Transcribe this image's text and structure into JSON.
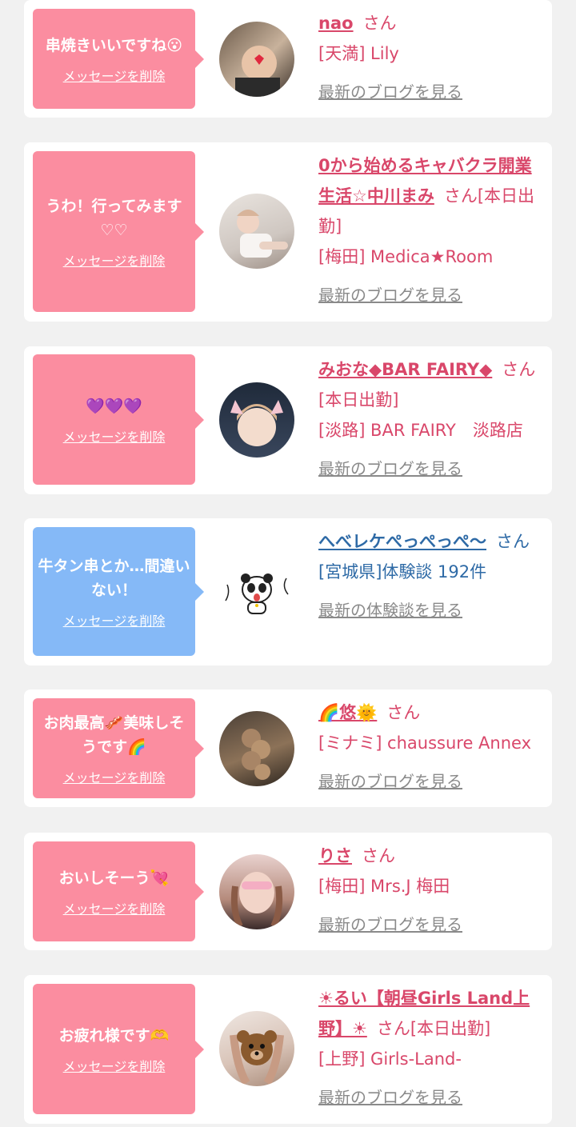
{
  "items": [
    {
      "message": "串焼きいいですね😮",
      "delete_label": "メッセージを削除",
      "name": "nao",
      "honorific": "さん",
      "shop": "[天満] Lily",
      "link": "最新のブログを見る",
      "theme": "pink"
    },
    {
      "message": "うわ！行ってみます♡♡",
      "delete_label": "メッセージを削除",
      "name": "0から始めるキャバクラ開業生活☆中川まみ",
      "honorific": "さん[本日出勤]",
      "shop": "[梅田] Medica★Room",
      "link": "最新のブログを見る",
      "theme": "pink"
    },
    {
      "message": "💜💜💜",
      "delete_label": "メッセージを削除",
      "name": "みおな◆BAR FAIRY◆",
      "honorific": "さん[本日出勤]",
      "shop": "[淡路] BAR FAIRY　淡路店",
      "link": "最新のブログを見る",
      "theme": "pink"
    },
    {
      "message": "牛タン串とか…間違いない！",
      "delete_label": "メッセージを削除",
      "name": "へべレケぺっぺっぺ〜",
      "honorific": "さん",
      "shop": "[宮城県]体験談 192件",
      "link": "最新の体験談を見る",
      "theme": "blue"
    },
    {
      "message": "お肉最高🥓美味しそうです🌈",
      "delete_label": "メッセージを削除",
      "name": "🌈悠🌞",
      "honorific": "さん",
      "shop": "[ミナミ] chaussure Annex",
      "link": "最新のブログを見る",
      "theme": "pink"
    },
    {
      "message": "おいしそーう💘",
      "delete_label": "メッセージを削除",
      "name": "りさ",
      "honorific": "さん",
      "shop": "[梅田] Mrs.J 梅田",
      "link": "最新のブログを見る",
      "theme": "pink"
    },
    {
      "message": "お疲れ様です🫶",
      "delete_label": "メッセージを削除",
      "name": "☀るい【朝昼Girls Land上野】☀",
      "honorific": "さん[本日出勤]",
      "shop": "[上野] Girls-Land-",
      "link": "最新のブログを見る",
      "theme": "pink"
    }
  ],
  "colors": {
    "pink": "#fb8da0",
    "blue": "#85b9f7",
    "name_pink": "#d9476a",
    "name_blue": "#2e6aa6"
  }
}
